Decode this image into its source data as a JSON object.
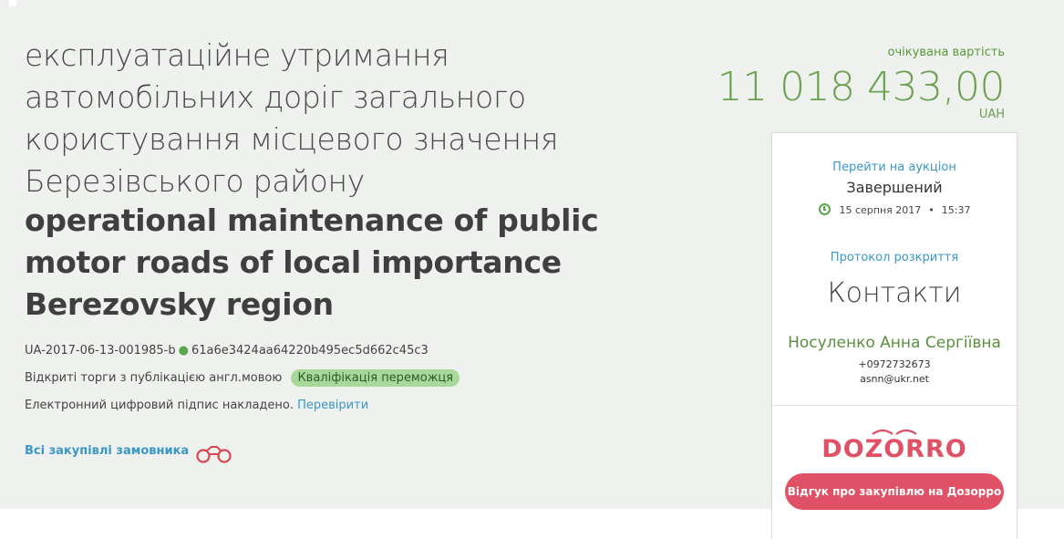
{
  "tender": {
    "title_ua": "експлуатаційне утримання автомобільних доріг загального користування місцевого значення Березівського району",
    "title_en": "operational maintenance of public motor roads of local importance Berezovsky region",
    "id": "UA-2017-06-13-001985-b",
    "hash": "61a6e3424aa64220b495ec5d662c45c3",
    "procedure": "Відкриті торги з публікацією англ.мовою",
    "status_badge": "Кваліфікація переможця",
    "signature_text": "Електронний цифровий підпис накладено.",
    "signature_link": "Перевірити",
    "all_purchases_link": "Всі закупівлі замовника"
  },
  "price": {
    "label": "очікувана вартість",
    "value": "11 018 433,00",
    "currency": "UAH"
  },
  "auction": {
    "link": "Перейти на аукціон",
    "status": "Завершений",
    "date": "15 серпня 2017",
    "time": "15:37"
  },
  "protocol": {
    "link": "Протокол розкриття"
  },
  "contacts": {
    "heading": "Контакти",
    "name": "Носуленко Анна Сергіївна",
    "phone": "+0972732673",
    "email": "asnn@ukr.net"
  },
  "dozorro": {
    "logo_text": "DOZORRO",
    "button_label": "Відгук про закупівлю на Дозорро"
  },
  "colors": {
    "accent_green": "#6aa04f",
    "link_blue": "#3b97c7",
    "dozorro_red": "#e05166",
    "badge_green": "#a8d89a"
  }
}
